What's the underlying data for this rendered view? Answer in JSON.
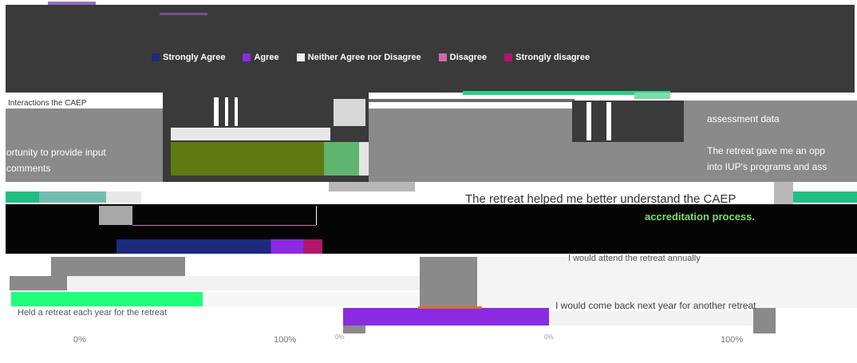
{
  "colors": {
    "strongly_agree": "#1b2a7a",
    "agree": "#8a2be2",
    "neither": "#f2f2f2",
    "disagree": "#d36aa8",
    "strongly_disagree": "#b0176b",
    "accent_green": "#1fbf83",
    "olive": "#5e7a10",
    "dark_bg": "#3a3a3a",
    "black": "#050505",
    "gray": "#8a8a8a"
  },
  "legend": [
    {
      "label": "Strongly Agree",
      "color_key": "strongly_agree"
    },
    {
      "label": "Agree",
      "color_key": "agree"
    },
    {
      "label": "Neither Agree nor Disagree",
      "color_key": "neither"
    },
    {
      "label": "Disagree",
      "color_key": "disagree"
    },
    {
      "label": "Strongly disagree",
      "color_key": "strongly_disagree"
    }
  ],
  "text": {
    "left_header": "Interactions the CAEP",
    "left_line1": "ortunity to provide input",
    "left_line2": "comments",
    "right_line1": "assessment data",
    "right_line2": "The retreat gave me an opp",
    "right_line3": "into IUP's programs and ass",
    "center_title_line1": "The retreat helped me better understand the CAEP",
    "center_title_line2": "accreditation process.",
    "center_mid": "I would attend the retreat annually",
    "bottom_left": "Held a retreat each year for the retreat",
    "bottom_right": "I would come back next year for another retreat",
    "tick_left_0": "0%",
    "tick_left_100": "100%",
    "tick_mid_0": "0%",
    "tick_right_0": "0%",
    "tick_right_100": "100%"
  },
  "chart_data": {
    "type": "bar",
    "orientation": "horizontal",
    "stacked": true,
    "categories": [
      "The retreat helped me better understand the CAEP accreditation process."
    ],
    "series": [
      {
        "name": "Strongly Agree",
        "values": [
          75
        ]
      },
      {
        "name": "Agree",
        "values": [
          16
        ]
      },
      {
        "name": "Neither Agree nor Disagree",
        "values": [
          0
        ]
      },
      {
        "name": "Disagree",
        "values": [
          0
        ]
      },
      {
        "name": "Strongly disagree",
        "values": [
          9
        ]
      }
    ],
    "xlim": [
      0,
      100
    ],
    "xticks": [
      "0%",
      "100%"
    ],
    "legend_position": "top"
  }
}
